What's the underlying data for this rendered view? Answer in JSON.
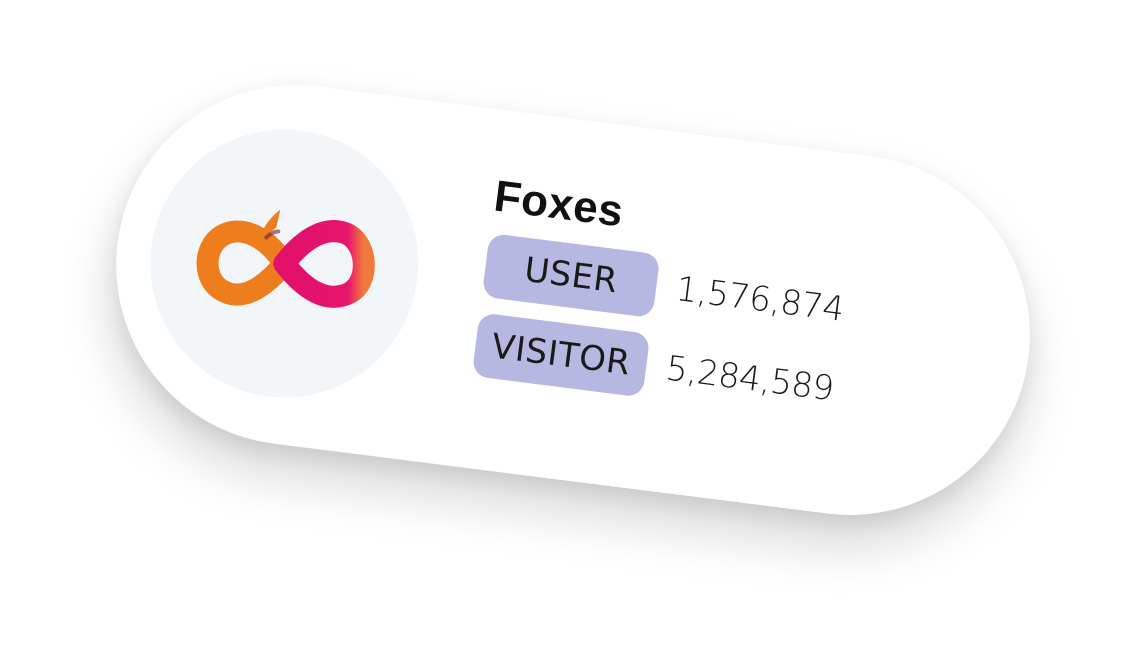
{
  "card": {
    "name": "Foxes",
    "logo_icon": "infinity-logo-icon",
    "stats": [
      {
        "label": "USER",
        "value": "1,576,874"
      },
      {
        "label": "VISITOR",
        "value": "5,284,589"
      }
    ]
  },
  "colors": {
    "badge_bg": "#b6b8e2",
    "logo_orange": "#ee7d1e",
    "logo_pink": "#e0106b",
    "logo_circle_bg": "#f3f6f9"
  }
}
